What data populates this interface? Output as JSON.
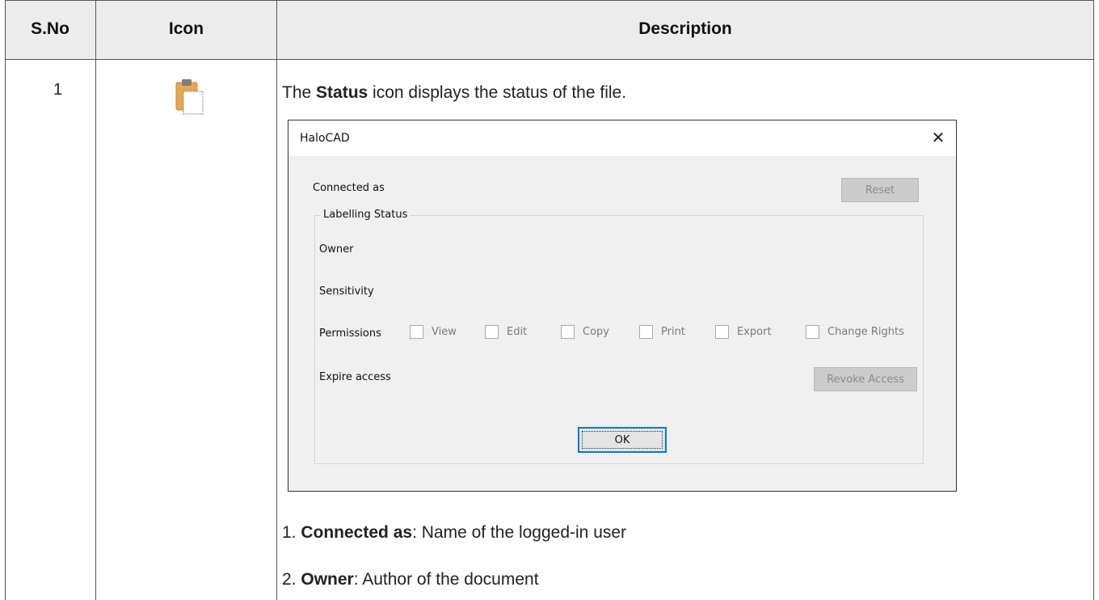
{
  "headers": {
    "sno": "S.No",
    "icon": "Icon",
    "description": "Description"
  },
  "row": {
    "sno": "1",
    "icon": "clipboard-icon",
    "intro": {
      "pre": "The ",
      "bold": "Status",
      "post": " icon displays the status of the file."
    },
    "list": [
      {
        "num": "1. ",
        "bold": "Connected as",
        "rest": ": Name of the logged-in user"
      },
      {
        "num": "2. ",
        "bold": "Owner",
        "rest": ": Author of the document"
      }
    ]
  },
  "dialog": {
    "title": "HaloCAD",
    "close": "✕",
    "connected_as": "Connected as",
    "reset": "Reset",
    "group_title": "Labelling Status",
    "owner": "Owner",
    "sensitivity": "Sensitivity",
    "permissions": "Permissions",
    "permission_options": [
      "View",
      "Edit",
      "Copy",
      "Print",
      "Export",
      "Change Rights"
    ],
    "expire_access": "Expire access",
    "revoke_access": "Revoke Access",
    "ok": "OK"
  }
}
